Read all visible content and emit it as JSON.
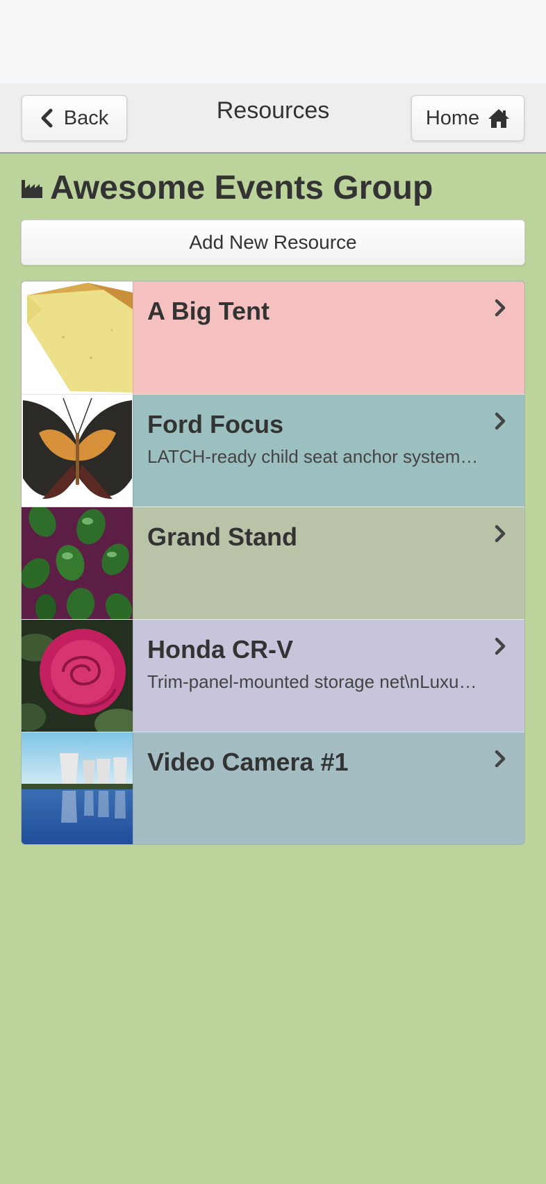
{
  "header": {
    "back_label": "Back",
    "title": "Resources",
    "home_label": "Home"
  },
  "group": {
    "name": "Awesome Events Group",
    "icon": "industry-icon"
  },
  "add_button_label": "Add New Resource",
  "resources": [
    {
      "name": "A Big Tent",
      "description": "",
      "bg": "#f4c0c0",
      "thumb": "cheese"
    },
    {
      "name": "Ford Focus",
      "description": "LATCH-ready child seat anchor system…",
      "bg": "#9cc0bf",
      "thumb": "butterfly"
    },
    {
      "name": "Grand Stand",
      "description": "",
      "bg": "#b8c3a7",
      "thumb": "pills"
    },
    {
      "name": "Honda CR-V",
      "description": "Trim-panel-mounted storage net\\nLuxu…",
      "bg": "#c7c5dc",
      "thumb": "rose"
    },
    {
      "name": "Video Camera #1",
      "description": "",
      "bg": "#a3bdc3",
      "thumb": "towers"
    }
  ],
  "colors": {
    "page_bg": "#bcd39c",
    "navbar_bg": "#eeeeee"
  }
}
